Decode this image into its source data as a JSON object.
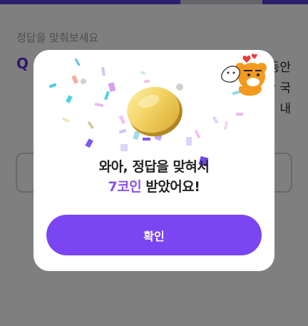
{
  "quiz": {
    "subtitle": "정답을 맞춰보세요",
    "q_mark": "Q",
    "question_fragments": [
      "동안",
      "한 국",
      "내"
    ]
  },
  "modal": {
    "message_line1": "와아, 정답을 맞혀서",
    "coin_amount": "7코인",
    "message_line2_suffix": " 받았어요!",
    "confirm_label": "확인",
    "coin_icon": "gold-coin-icon",
    "character_icon": "ryan-character-icon"
  },
  "colors": {
    "accent": "#7b45f2",
    "accent_text": "#8a52ee",
    "top_bar": "#5a3fdc"
  }
}
